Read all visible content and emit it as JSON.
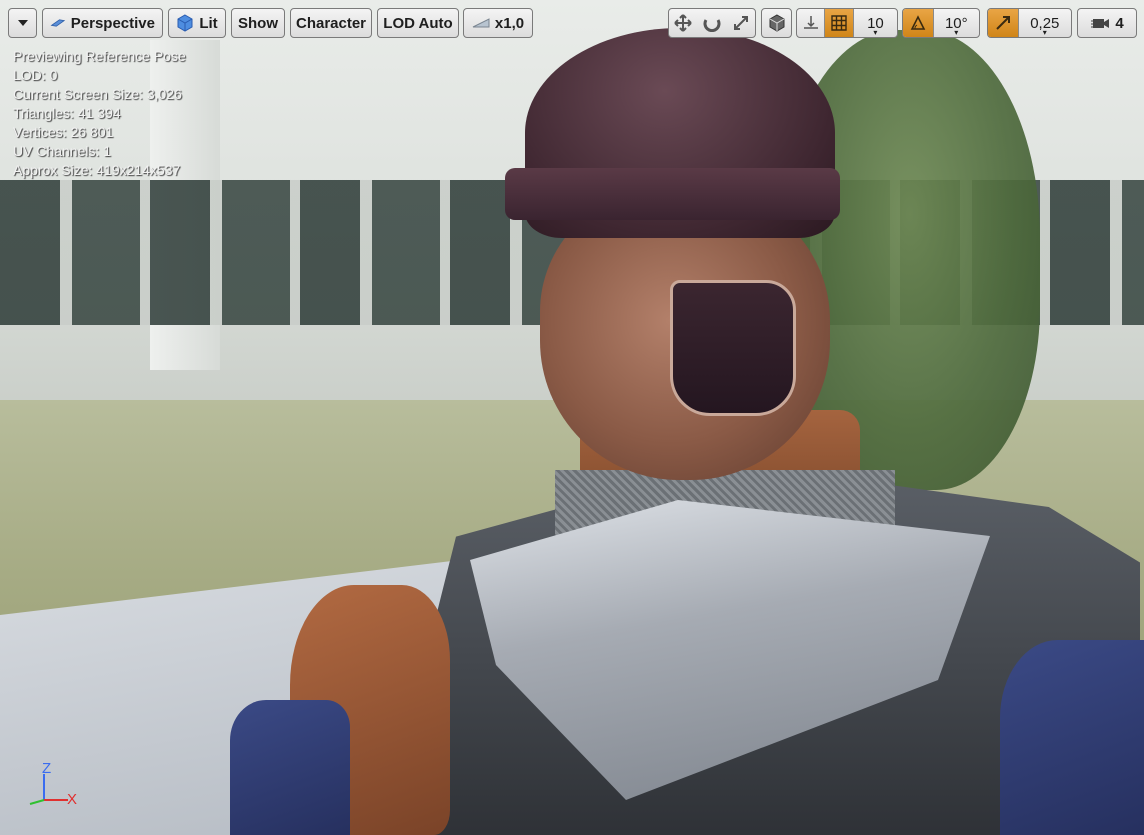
{
  "toolbar": {
    "menu_icon": "chevron-down-icon",
    "perspective_label": "Perspective",
    "lit_label": "Lit",
    "show_label": "Show",
    "character_label": "Character",
    "lod_label": "LOD Auto",
    "speed_label": "x1,0",
    "grid_snap_value": "10",
    "rotation_snap_value": "10°",
    "scale_snap_value": "0,25",
    "camera_speed_value": "4",
    "active_color": "#e09a33"
  },
  "stats": {
    "line1": "Previewing Reference Pose",
    "line2": "LOD: 0",
    "line3": "Current Screen Size: 3,026",
    "line4": "Triangles: 41 394",
    "line5": "Vertices: 26 801",
    "line6": "UV Channels: 1",
    "line7": "Approx Size: 419x214x537"
  },
  "axis_gizmo": {
    "z_label": "Z",
    "x_label": "X",
    "z_color": "#3a6cf0",
    "x_color": "#e03030",
    "y_color": "#30c030"
  }
}
